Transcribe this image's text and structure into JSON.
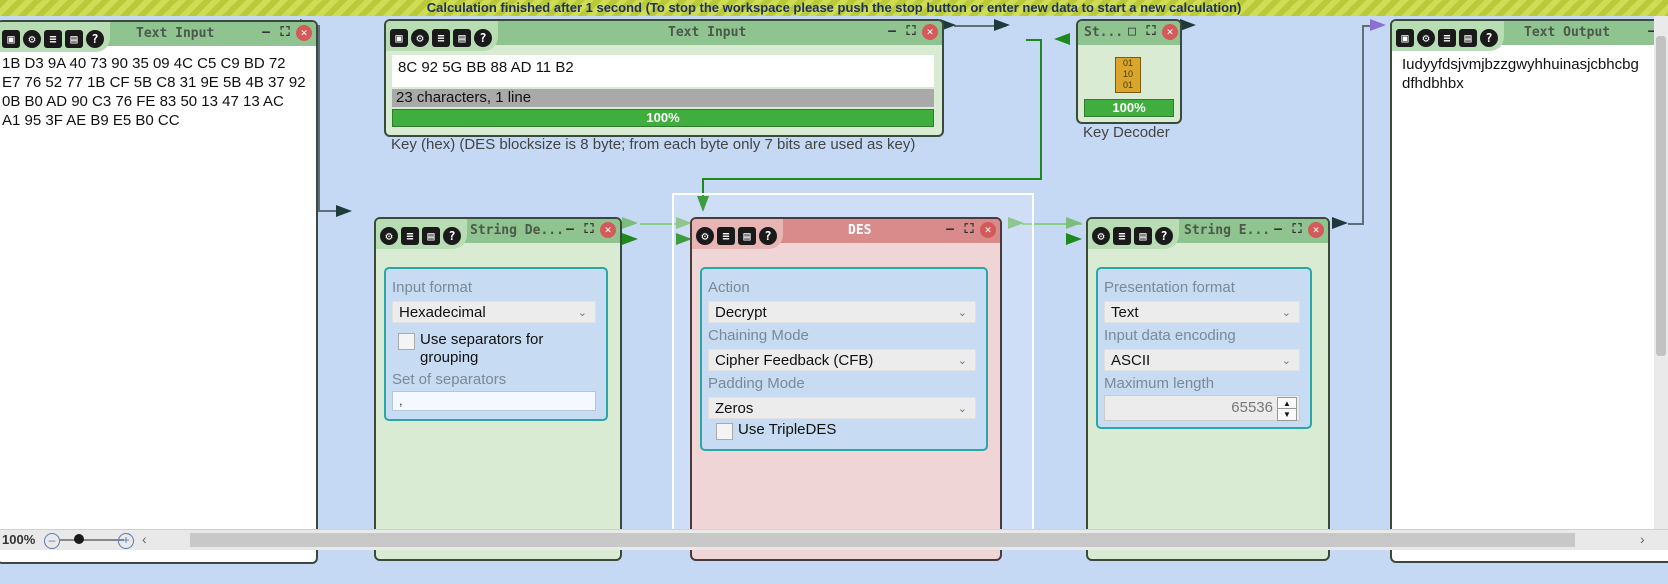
{
  "banner": "Calculation finished after 1 second (To stop the workspace please push the stop button or enter new data to start a new calculation)",
  "text_input_left": {
    "title": "Text Input",
    "lines": [
      "1B D3 9A 40 73 90 35 09 4C C5 C9 BD 72",
      "E7 76 52 77 1B CF 5B C8 31 9E 5B 4B 37 92",
      "0B B0 AD 90 C3 76 FE 83 50 13 47 13 AC",
      "A1 95 3F AE B9 E5 B0 CC"
    ]
  },
  "text_input_key": {
    "title": "Text Input",
    "value": "8C 92 5G BB 88 AD 11 B2",
    "stats": "23 characters,  1 line",
    "progress": "100%",
    "caption": "Key (hex) (DES blocksize is 8 byte; from each byte only 7 bits are used as key)"
  },
  "key_decoder": {
    "title": "St...",
    "progress": "100%",
    "caption": "Key Decoder"
  },
  "text_output": {
    "title": "Text Output",
    "lines": [
      "Iudyyfdsjvmjbzzgwyhhuinasjcbhcbg",
      "dfhdbhbx"
    ]
  },
  "string_decoder": {
    "title": "String De...",
    "input_format_label": "Input format",
    "input_format_value": "Hexadecimal",
    "use_separators_label_1": "Use separators for",
    "use_separators_label_2": "grouping",
    "set_of_separators_label": "Set of separators",
    "separators_value": ","
  },
  "des": {
    "title": "DES",
    "action_label": "Action",
    "action_value": "Decrypt",
    "chaining_label": "Chaining Mode",
    "chaining_value": "Cipher Feedback (CFB)",
    "padding_label": "Padding Mode",
    "padding_value": "Zeros",
    "triple_label": "Use TripleDES"
  },
  "string_encoder": {
    "title": "String E...",
    "presentation_label": "Presentation format",
    "presentation_value": "Text",
    "encoding_label": "Input data encoding",
    "encoding_value": "ASCII",
    "maxlen_label": "Maximum length",
    "maxlen_value": "65536"
  },
  "statusbar": {
    "zoom": "100%"
  },
  "colors": {
    "canvas": "#c5d9f5",
    "component_green": "#d9ecd3",
    "des_red": "#efd5d5",
    "progress_green": "#3fae3f",
    "group_border": "#2aa7a7"
  }
}
